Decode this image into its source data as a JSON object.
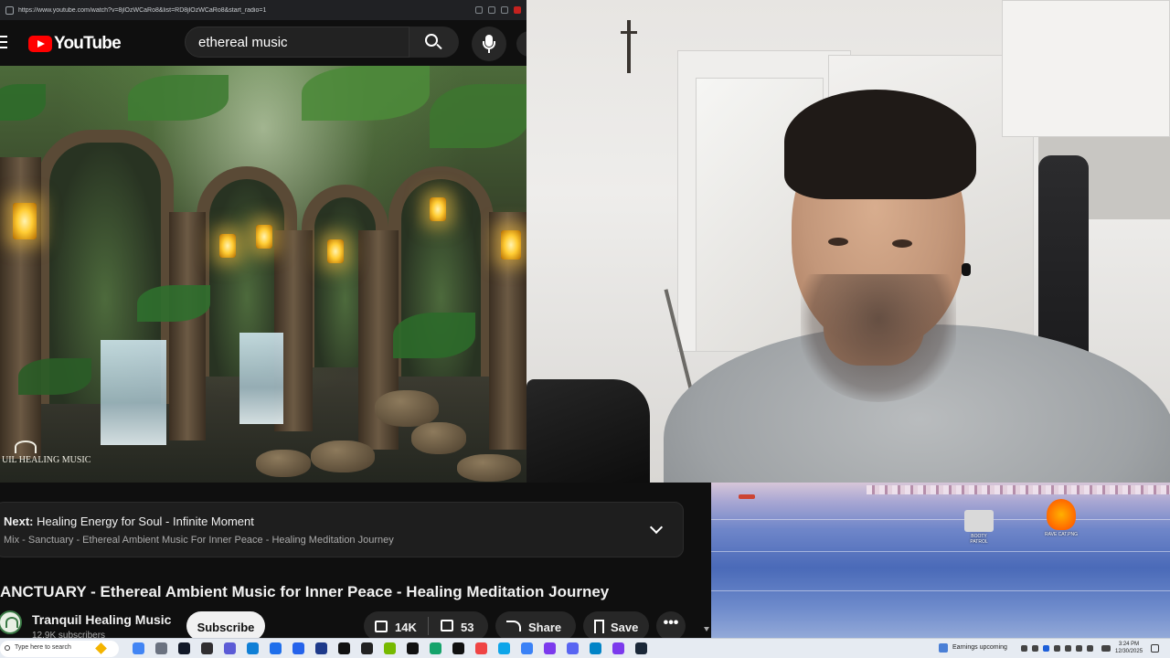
{
  "browser": {
    "url": "https://www.youtube.com/watch?v=8jlOzWCaRo8&list=RD8jlOzWCaRo8&start_radio=1"
  },
  "youtube": {
    "logo_text": "YouTube",
    "search_value": "ethereal music",
    "watermark_text": "UIL HEALING MUSIC"
  },
  "info": {
    "next_label": "Next:",
    "next_title": "Healing Energy for Soul - Infinite Moment",
    "mix_line": "Mix - Sanctuary - Ethereal Ambient Music For Inner Peace - Healing Meditation Journey",
    "video_title": "ANCTUARY - Ethereal Ambient Music for Inner Peace - Healing Meditation Journey",
    "channel_name": "Tranquil Healing Music",
    "subscriber_text": "12.9K subscribers",
    "subscribe_label": "Subscribe",
    "like_count": "14K",
    "dislike_count": "53",
    "share_label": "Share",
    "save_label": "Save",
    "more_label": "•••"
  },
  "desktop": {
    "icons": [
      {
        "label": "BOOTY PATROL",
        "color": "#d9d9d9"
      },
      {
        "label": "RAVE CAT.PNG",
        "color": "#ff6a00"
      }
    ]
  },
  "taskbar": {
    "search_placeholder": "Type here to search",
    "earnings_text": "Earnings upcoming",
    "time": "3:24 PM",
    "date": "12/30/2025",
    "apps": [
      {
        "name": "chrome-icon",
        "color": "#4285f4"
      },
      {
        "name": "task-view-icon",
        "color": "#6b7280"
      },
      {
        "name": "app-icon",
        "color": "#111827"
      },
      {
        "name": "obs-icon",
        "color": "#302e31"
      },
      {
        "name": "app-icon",
        "color": "#5b5bd6"
      },
      {
        "name": "edge-icon",
        "color": "#0f7fd6"
      },
      {
        "name": "folder-icon",
        "color": "#1f6feb"
      },
      {
        "name": "app-icon",
        "color": "#2563eb"
      },
      {
        "name": "app-icon",
        "color": "#1e3a8a"
      },
      {
        "name": "app-icon",
        "color": "#111111"
      },
      {
        "name": "app-icon",
        "color": "#222222"
      },
      {
        "name": "nvidia-icon",
        "color": "#76b900"
      },
      {
        "name": "app-icon",
        "color": "#111111"
      },
      {
        "name": "app-icon",
        "color": "#15a36b"
      },
      {
        "name": "app-icon",
        "color": "#111111"
      },
      {
        "name": "app-icon",
        "color": "#ef4444"
      },
      {
        "name": "app-icon",
        "color": "#0ea5e9"
      },
      {
        "name": "app-icon",
        "color": "#3b82f6"
      },
      {
        "name": "app-icon",
        "color": "#7c3aed"
      },
      {
        "name": "discord-icon",
        "color": "#5865f2"
      },
      {
        "name": "app-icon",
        "color": "#0284c7"
      },
      {
        "name": "app-icon",
        "color": "#7c3aed"
      },
      {
        "name": "steam-icon",
        "color": "#1b2838"
      }
    ]
  }
}
